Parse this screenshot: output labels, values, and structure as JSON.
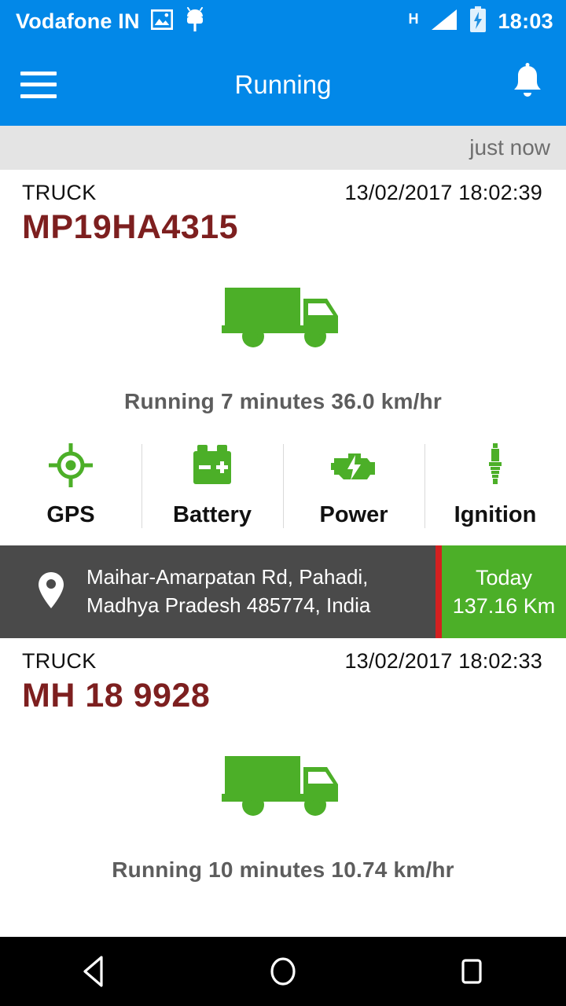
{
  "status_bar": {
    "carrier": "Vodafone IN",
    "network_type": "H",
    "clock": "18:03",
    "icons": [
      "image-icon",
      "android-icon",
      "signal-icon",
      "battery-charging-icon"
    ]
  },
  "app_bar": {
    "title": "Running",
    "menu_icon": "hamburger-menu-icon",
    "notification_icon": "bell-icon"
  },
  "refresh_strip": {
    "label": "just now"
  },
  "colors": {
    "primary_blue": "#0288E8",
    "accent_green": "#4CAF28",
    "plate_red": "#7d1f1f",
    "address_bg": "#4a4a4a",
    "divider_red": "#d32020",
    "strip_gray": "#e4e4e4"
  },
  "indicator_labels": {
    "gps": "GPS",
    "battery": "Battery",
    "power": "Power",
    "ignition": "Ignition"
  },
  "vehicles": [
    {
      "type_label": "TRUCK",
      "timestamp": "13/02/2017 18:02:39",
      "plate": "MP19HA4315",
      "status_text": "Running 7 minutes 36.0 km/hr",
      "vehicle_icon": "truck-icon",
      "indicators": [
        {
          "name": "GPS",
          "icon": "gps-crosshair-icon",
          "state": "active"
        },
        {
          "name": "Battery",
          "icon": "battery-icon",
          "state": "active"
        },
        {
          "name": "Power",
          "icon": "engine-power-icon",
          "state": "active"
        },
        {
          "name": "Ignition",
          "icon": "spark-plug-icon",
          "state": "active"
        }
      ],
      "address": "Maihar-Amarpatan Rd, Pahadi, Madhya Pradesh 485774, India",
      "address_line1": "Maihar-Amarpatan Rd, Pahadi,",
      "address_line2": "Madhya Pradesh 485774, India",
      "distance_period": "Today",
      "distance_value": "137.16 Km"
    },
    {
      "type_label": "TRUCK",
      "timestamp": "13/02/2017 18:02:33",
      "plate": "MH 18  9928",
      "status_text": "Running 10 minutes 10.74 km/hr",
      "vehicle_icon": "truck-icon"
    }
  ],
  "nav_bar": {
    "back": "back-triangle-icon",
    "home": "home-circle-icon",
    "recents": "recents-square-icon"
  }
}
